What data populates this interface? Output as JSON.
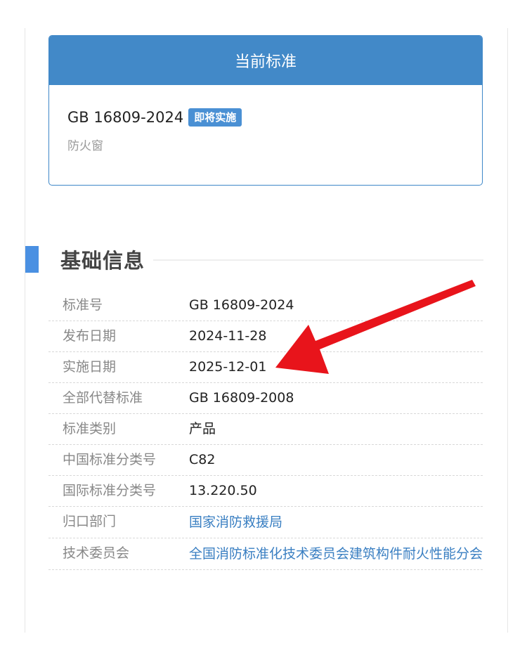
{
  "current_standard": {
    "header": "当前标准",
    "code": "GB 16809-2024",
    "badge": "即将实施",
    "name": "防火窗"
  },
  "basic_info": {
    "title": "基础信息",
    "rows": [
      {
        "label": "标准号",
        "value": "GB 16809-2024"
      },
      {
        "label": "发布日期",
        "value": "2024-11-28"
      },
      {
        "label": "实施日期",
        "value": "2025-12-01"
      },
      {
        "label": "全部代替标准",
        "value": "GB 16809-2008"
      },
      {
        "label": "标准类别",
        "value": "产品"
      },
      {
        "label": "中国标准分类号",
        "value": "C82"
      },
      {
        "label": "国际标准分类号",
        "value": "13.220.50"
      },
      {
        "label": "归口部门",
        "value": "国家消防救援局"
      },
      {
        "label": "技术委员会",
        "value": "全国消防标准化技术委员会建筑构件耐火性能分会"
      }
    ]
  },
  "colors": {
    "panel_header": "#4289c8",
    "badge": "#4a90d4",
    "section_marker": "#4a90e2",
    "link": "#3a7fc2",
    "annotation_arrow": "#e8141b"
  },
  "annotation": {
    "icon": "red-arrow-icon"
  }
}
